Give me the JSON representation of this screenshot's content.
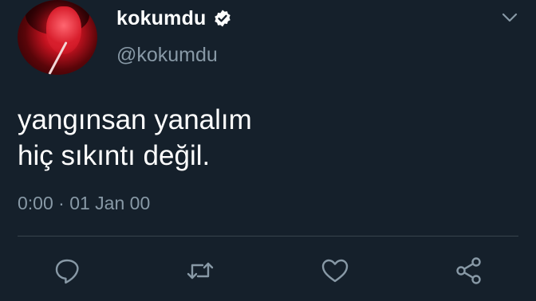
{
  "tweet": {
    "display_name": "kokumdu",
    "handle": "@kokumdu",
    "verified": true,
    "text_lines": [
      "yangınsan yanalım",
      "hiç sıkıntı değil."
    ],
    "timestamp": "0:00 · 01 Jan 00"
  },
  "actions": [
    {
      "name": "reply",
      "icon": "reply-icon"
    },
    {
      "name": "retweet",
      "icon": "retweet-icon"
    },
    {
      "name": "like",
      "icon": "heart-icon"
    },
    {
      "name": "share",
      "icon": "share-icon"
    }
  ],
  "colors": {
    "background": "#15202b",
    "secondary_text": "#8899a6",
    "icon": "#8899a6",
    "divider": "#38444d",
    "verified_badge": "#ffffff"
  }
}
